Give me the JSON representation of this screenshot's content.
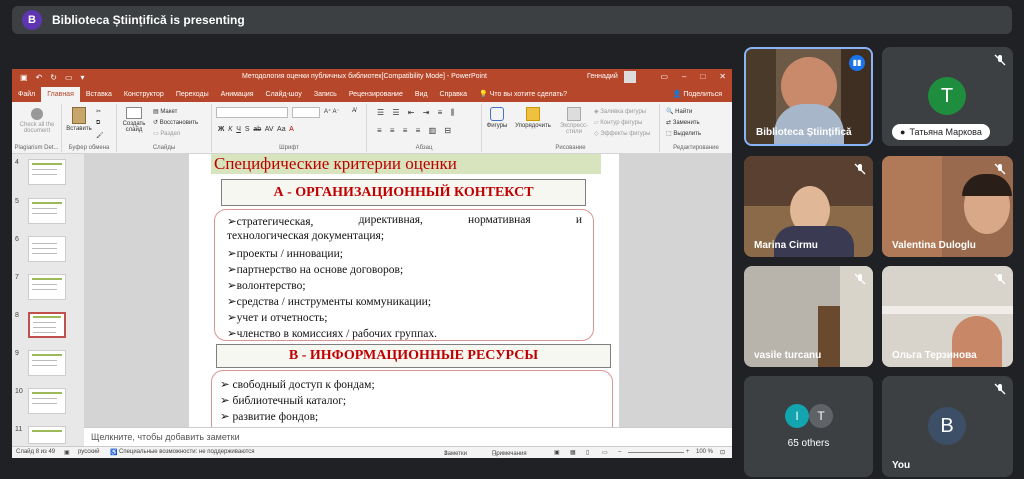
{
  "presenting": {
    "initial": "B",
    "text": "Biblioteca Științifică is presenting"
  },
  "ppt": {
    "window_title": "Методология оценки публичных библиотек[Compatibility Mode] - PowerPoint",
    "user": "Геннадий",
    "tabs": [
      "Файл",
      "Главная",
      "Вставка",
      "Конструктор",
      "Переходы",
      "Анимация",
      "Слайд-шоу",
      "Запись",
      "Рецензирование",
      "Вид",
      "Справка"
    ],
    "active_tab": "Главная",
    "tell_me": "Что вы хотите сделать?",
    "share": "Поделиться",
    "ribbon": {
      "check_docs": "Check all the document",
      "plagiarism": "Plagiarism Det...",
      "paste": "Вставить",
      "clipboard": "Буфер обмена",
      "create_slide": "Создать слайд",
      "layout": "Макет",
      "reset": "Восстановить",
      "section": "Раздел",
      "slides": "Слайды",
      "font": "Шрифт",
      "paragraph": "Абзац",
      "shapes": "Фигуры",
      "arrange": "Упорядочить",
      "quick_styles": "Экспресс-стили",
      "shape_fill": "Заливка фигуры",
      "shape_outline": "Контур фигуры",
      "shape_effects": "Эффекты фигуры",
      "drawing": "Рисование",
      "find": "Найти",
      "replace": "Заменить",
      "select": "Выделить",
      "editing": "Редактирование",
      "font_buttons": [
        "Ж",
        "К",
        "Ч",
        "S",
        "ab",
        "AV",
        "Aa",
        "A"
      ]
    },
    "slide_numbers": [
      "4",
      "5",
      "6",
      "7",
      "8",
      "9",
      "10",
      "11"
    ],
    "selected_slide": "8",
    "slide": {
      "title": "Специфические критерии оценки",
      "section_a": "А - ОРГАНИЗАЦИОННЫЙ КОНТЕКСТ",
      "first_line_words": [
        "➢стратегическая,",
        "директивная,",
        "нормативная",
        "и"
      ],
      "first_line_cont": "технологическая документация;",
      "a_items": [
        "➢проекты / инновации;",
        "➢партнерство на основе договоров;",
        "➢волонтерство;",
        "➢средства / инструменты коммуникации;",
        "➢учет и отчетность;",
        "➢членство в комиссиях / рабочих группах."
      ],
      "section_b": "В - ИНФОРМАЦИОННЫЕ РЕСУРСЫ",
      "b_items": [
        "➢ свободный доступ к фондам;",
        "➢ библиотечный каталог;",
        "➢ развитие фондов;"
      ]
    },
    "notes_placeholder": "Щелкните, чтобы добавить заметки",
    "status": {
      "slide_count": "Слайд 8 из 49",
      "language": "русский",
      "accessibility": "Специальные возможности: не поддерживаются",
      "notes": "Заметки",
      "comments": "Примечания",
      "zoom": "100 %"
    }
  },
  "participants": [
    {
      "name": "Biblioteca Științifică",
      "speaking": true
    },
    {
      "name": "Татьяна Маркова",
      "initial": "Т",
      "color": "#1e8e3e",
      "muted": true
    },
    {
      "name": "Marina Cirmu",
      "muted": true
    },
    {
      "name": "Valentina Duloglu",
      "muted": true
    },
    {
      "name": "vasile turcanu",
      "muted": true
    },
    {
      "name": "Ольга Терзинова",
      "muted": true
    },
    {
      "name": "65 others",
      "initials": [
        "I",
        "T"
      ],
      "colors": [
        "#12a4af",
        "#5f6368"
      ]
    },
    {
      "name": "You",
      "initial": "B",
      "color": "#3c4f66",
      "muted": true
    }
  ]
}
